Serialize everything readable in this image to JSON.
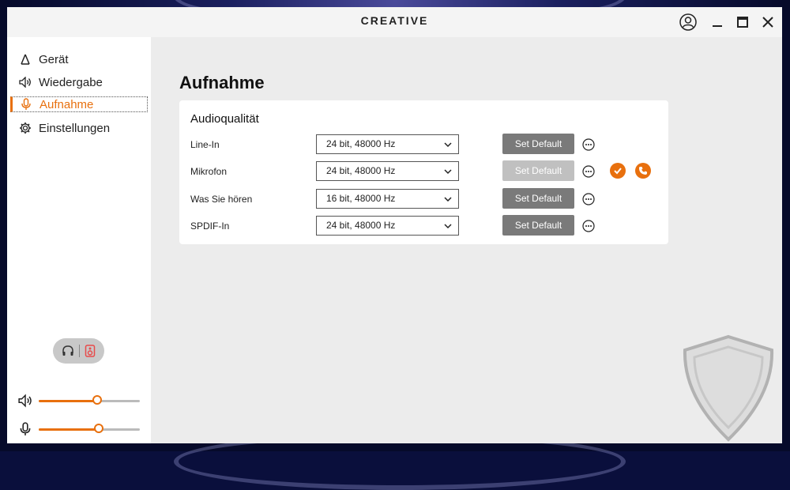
{
  "window": {
    "brand": "CREATIVE"
  },
  "sidebar": {
    "items": [
      {
        "label": "Gerät",
        "icon": "device-icon",
        "active": false
      },
      {
        "label": "Wiedergabe",
        "icon": "speaker-icon",
        "active": false
      },
      {
        "label": "Aufnahme",
        "icon": "microphone-icon",
        "active": true
      },
      {
        "label": "Einstellungen",
        "icon": "gear-icon",
        "active": false
      }
    ],
    "output_toggle": {
      "left_icon": "headphones-icon",
      "right_icon": "speaker-box-icon"
    },
    "volume": {
      "level": 0.58
    },
    "mic_volume": {
      "level": 0.59
    }
  },
  "main": {
    "title": "Aufnahme",
    "section_title": "Audioqualität",
    "rows": [
      {
        "label": "Line-In",
        "value": "24 bit, 48000 Hz",
        "button": "Set Default",
        "button_enabled": true
      },
      {
        "label": "Mikrofon",
        "value": "24 bit, 48000 Hz",
        "button": "Set Default",
        "button_enabled": false
      },
      {
        "label": "Was Sie hören",
        "value": "16 bit, 48000 Hz",
        "button": "Set Default",
        "button_enabled": true
      },
      {
        "label": "SPDIF-In",
        "value": "24 bit, 48000 Hz",
        "button": "Set Default",
        "button_enabled": true
      }
    ]
  },
  "colors": {
    "accent": "#e8700e",
    "button": "#7a7a7a",
    "button_disabled": "#c0c0c0"
  }
}
